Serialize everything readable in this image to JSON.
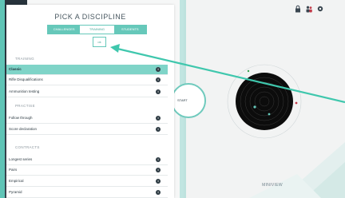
{
  "panel": {
    "title": "PICK A DISCIPLINE",
    "tabs": [
      {
        "label": "CHALLENGES",
        "active": false
      },
      {
        "label": "TRAINING",
        "active": true
      },
      {
        "label": "STUDENTS",
        "active": false
      }
    ],
    "small_button_label": "ok",
    "sections": [
      {
        "title": "TRAINING",
        "items": [
          {
            "label": "Classic",
            "selected": true
          },
          {
            "label": "Rifle Disqualifications",
            "selected": false
          },
          {
            "label": "Ammunition testing",
            "selected": false
          }
        ]
      },
      {
        "title": "PRACTISE",
        "items": [
          {
            "label": "Follow through",
            "selected": false
          },
          {
            "label": "Score declaration",
            "selected": false
          }
        ]
      },
      {
        "title": "CONTRACTS",
        "items": [
          {
            "label": "Longest series",
            "selected": false
          },
          {
            "label": "Pairs",
            "selected": false
          },
          {
            "label": "Empirical",
            "selected": false
          },
          {
            "label": "Pyramid",
            "selected": false
          }
        ]
      }
    ]
  },
  "right_view": {
    "view_label": "MINIVIEW",
    "mode_label": "START",
    "icons": [
      "lock-icon",
      "people-icon",
      "settings-icon"
    ]
  },
  "colors": {
    "accent": "#66c8ba",
    "selected_row": "#7fd4c8",
    "dark_strip": "#2f3a44",
    "arrow": "#3fc7ad"
  }
}
